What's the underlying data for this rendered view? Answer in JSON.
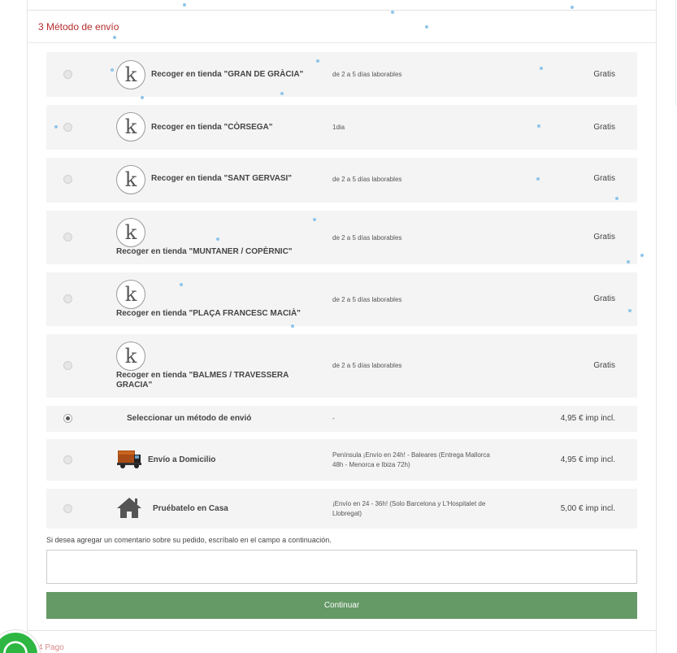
{
  "checkout": {
    "shipping_step_title": "3 Método de envío",
    "payment_step_title": "4 Pago"
  },
  "store_logo_letter": "k",
  "carriers": [
    {
      "name": "Recoger en tienda \"GRAN DE GRÀCIA\"",
      "delay": "de 2 a 5 días laborables",
      "price": "Gratis",
      "selected": false
    },
    {
      "name": "Recoger en tienda \"CÒRSEGA\"",
      "delay": "1dia",
      "price": "Gratis",
      "selected": false
    },
    {
      "name": "Recoger en tienda \"SANT GERVASI\"",
      "delay": "de 2 a 5 días laborables",
      "price": "Gratis",
      "selected": false
    },
    {
      "name": "Recoger en tienda \"MUNTANER / COPÈRNIC\"",
      "delay": "de 2 a 5 días laborables",
      "price": "Gratis",
      "selected": false
    },
    {
      "name": "Recoger en tienda \"PLAÇA FRANCESC MACIÀ\"",
      "delay": "de 2 a 5 días laborables",
      "price": "Gratis",
      "selected": false
    },
    {
      "name": "Recoger en tienda \"BALMES / TRAVESSERA GRACIA\"",
      "delay": "de 2 a 5 días laborables",
      "price": "Gratis",
      "selected": false
    },
    {
      "name": "Seleccionar un método de envió",
      "delay": "-",
      "price": "4,95 € imp incl.",
      "selected": true
    },
    {
      "name": "Envío a Domicilio",
      "delay": "Península ¡Envío en 24h! - Baleares (Entrega Mallorca 48h - Menorca e Ibiza 72h)",
      "price": "4,95 € imp incl.",
      "selected": false
    },
    {
      "name": "Pruébatelo en Casa",
      "delay": "¡Envío en 24 - 36h! (Solo Barcelona y L'Hospitalet de Llobregat)",
      "price": "5,00 € imp incl.",
      "selected": false
    }
  ],
  "comment": {
    "label": "Si desea agregar un comentario sobre su pedido, escríbalo en el campo a continuación.",
    "value": ""
  },
  "continue_label": "Continuar",
  "icons": {
    "store_logo": "k-logo-icon",
    "truck": "truck-icon",
    "house": "house-icon",
    "chat": "whatsapp-icon"
  },
  "colors": {
    "step_title": "#b52c2c",
    "continue_button": "#659966",
    "whatsapp": "#2db742"
  }
}
